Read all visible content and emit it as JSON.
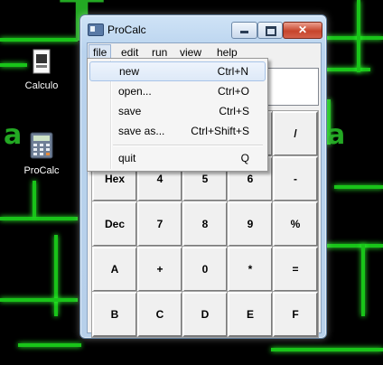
{
  "desktop": {
    "icons": [
      {
        "label": "Calculo",
        "icon": "document-icon"
      },
      {
        "label": "ProCalc",
        "icon": "calculator-icon"
      }
    ]
  },
  "window": {
    "title": "ProCalc",
    "menus": [
      "file",
      "edit",
      "run",
      "view",
      "help"
    ],
    "active_menu": "file",
    "close_symbol": "✕"
  },
  "file_menu": {
    "items": [
      {
        "label": "new",
        "shortcut": "Ctrl+N"
      },
      {
        "label": "open...",
        "shortcut": "Ctrl+O"
      },
      {
        "label": "save",
        "shortcut": "Ctrl+S"
      },
      {
        "label": "save as...",
        "shortcut": "Ctrl+Shift+S"
      },
      {
        "label": "quit",
        "shortcut": "Q"
      }
    ]
  },
  "keypad": {
    "rows": [
      [
        "",
        "",
        "",
        "/"
      ],
      [
        "Hex",
        "4",
        "5",
        "6",
        "-"
      ],
      [
        "Dec",
        "7",
        "8",
        "9",
        "%"
      ],
      [
        "A",
        "+",
        "0",
        "*",
        "="
      ],
      [
        "B",
        "C",
        "D",
        "E",
        "F"
      ]
    ]
  },
  "colors": {
    "wallpaper_green": "#19c419",
    "menu_highlight": "#dde9f8",
    "close_button": "#c7452c"
  }
}
